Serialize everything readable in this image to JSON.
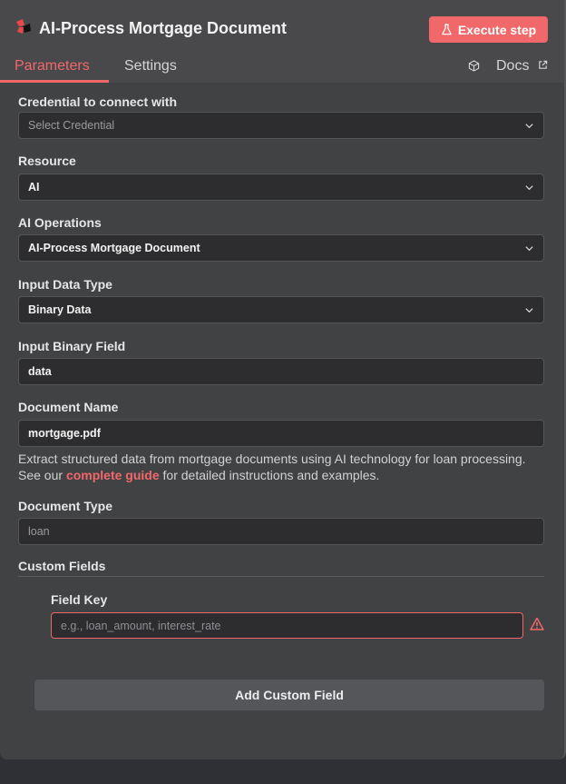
{
  "header": {
    "title": "AI-Process Mortgage Document",
    "execute_label": "Execute step"
  },
  "tabs": {
    "parameters": "Parameters",
    "settings": "Settings",
    "docs": "Docs"
  },
  "form": {
    "credential": {
      "label": "Credential to connect with",
      "value": "Select Credential"
    },
    "resource": {
      "label": "Resource",
      "value": "AI"
    },
    "operation": {
      "label": "AI Operations",
      "value": "AI-Process Mortgage Document"
    },
    "input_type": {
      "label": "Input Data Type",
      "value": "Binary Data"
    },
    "binary_field": {
      "label": "Input Binary Field",
      "value": "data"
    },
    "document_name": {
      "label": "Document Name",
      "value": "mortgage.pdf"
    },
    "description": {
      "before": "Extract structured data from mortgage documents using AI technology for loan processing. See our ",
      "link": "complete guide",
      "after": " for detailed instructions and examples."
    },
    "document_type": {
      "label": "Document Type",
      "value": "loan"
    },
    "custom_fields": {
      "label": "Custom Fields"
    },
    "field_key": {
      "label": "Field Key",
      "placeholder": "e.g., loan_amount, interest_rate"
    },
    "add_button": "Add Custom Field"
  },
  "colors": {
    "accent": "#f0686a",
    "panel": "#414244",
    "input_bg": "#2d2d2f"
  },
  "icons": [
    "app-logo-icon",
    "flask-icon",
    "cube-icon",
    "external-link-icon",
    "chevron-down-icon",
    "warning-icon"
  ]
}
